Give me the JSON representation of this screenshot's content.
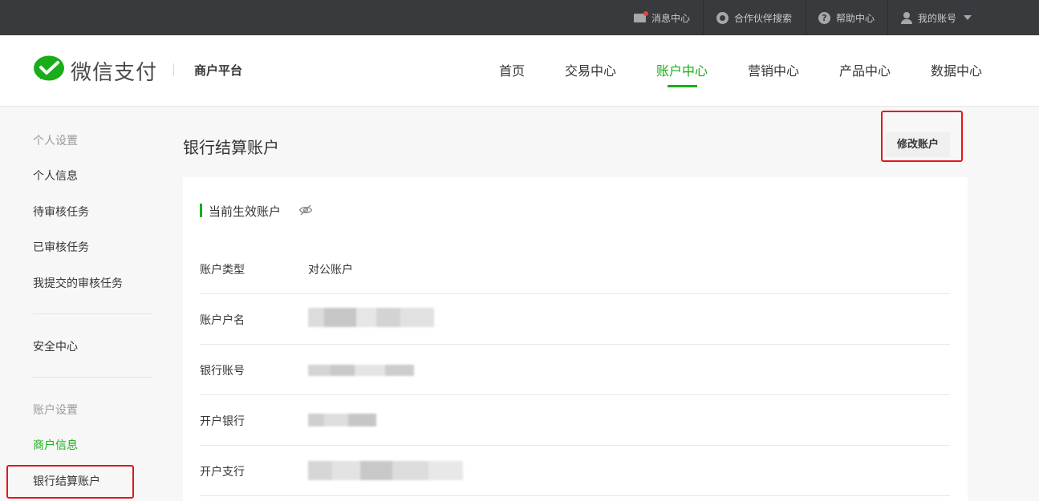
{
  "topbar": {
    "items": [
      {
        "label": "消息中心",
        "icon": "mail-icon"
      },
      {
        "label": "合作伙伴搜索",
        "icon": "search-icon"
      },
      {
        "label": "帮助中心",
        "icon": "help-icon"
      },
      {
        "label": "我的账号",
        "icon": "user-icon"
      }
    ]
  },
  "header": {
    "brand": "微信支付",
    "sub_brand": "商户平台",
    "nav": [
      "首页",
      "交易中心",
      "账户中心",
      "营销中心",
      "产品中心",
      "数据中心"
    ],
    "active_nav": "账户中心"
  },
  "sidebar": {
    "group1": "个人设置",
    "items1": [
      "个人信息",
      "待审核任务",
      "已审核任务",
      "我提交的审核任务"
    ],
    "security": "安全中心",
    "group2": "账户设置",
    "items2": [
      "商户信息",
      "银行结算账户"
    ]
  },
  "main": {
    "title": "银行结算账户",
    "edit_button": "修改账户",
    "section_title": "当前生效账户",
    "rows": [
      {
        "label": "账户类型",
        "value": "对公账户"
      },
      {
        "label": "账户户名",
        "value": ""
      },
      {
        "label": "银行账号",
        "value": ""
      },
      {
        "label": "开户银行",
        "value": ""
      },
      {
        "label": "开户支行",
        "value": ""
      }
    ]
  },
  "colors": {
    "accent": "#1aad19",
    "topbar": "#393a3e",
    "highlight": "#e8141c"
  }
}
